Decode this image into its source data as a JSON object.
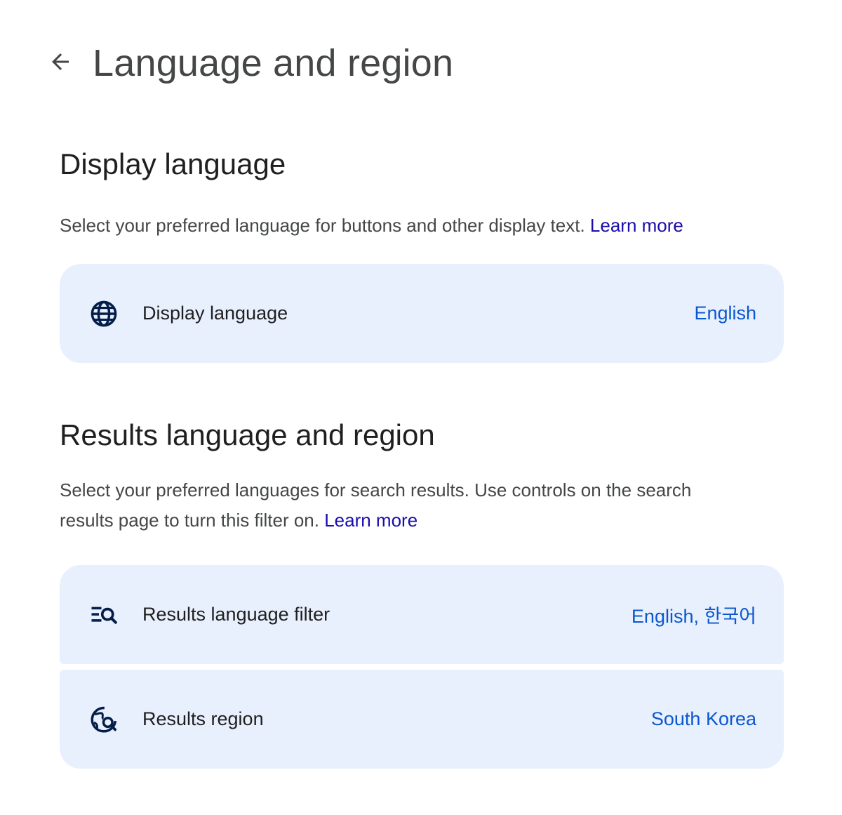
{
  "header": {
    "title": "Language and region",
    "back_icon": "arrow-back-icon"
  },
  "display_language": {
    "title": "Display language",
    "description": "Select your preferred language for buttons and other display text.",
    "learn_more": "Learn more",
    "rows": [
      {
        "icon": "globe-icon",
        "label": "Display language",
        "value": "English"
      }
    ]
  },
  "results_language_region": {
    "title": "Results language and region",
    "description": "Select your preferred languages for search results. Use controls on the search results page to turn this filter on.",
    "learn_more": "Learn more",
    "rows": [
      {
        "icon": "filter-search-icon",
        "label": "Results language filter",
        "value": "English, 한국어"
      },
      {
        "icon": "globe-search-icon",
        "label": "Results region",
        "value": "South Korea"
      }
    ]
  },
  "colors": {
    "card_background": "#e9f0fd",
    "value_text": "#0b57d0",
    "link": "#1a0dab",
    "icon": "#041e49"
  }
}
